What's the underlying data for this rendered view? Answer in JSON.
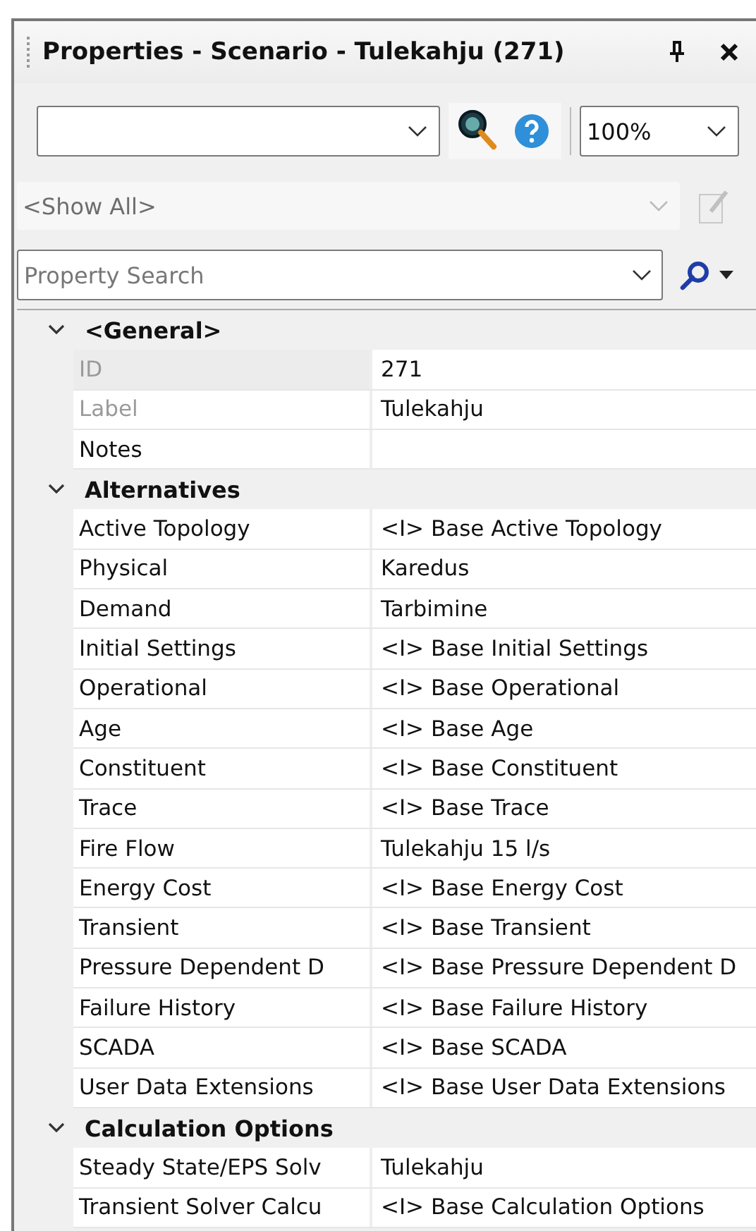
{
  "window": {
    "title": "Properties - Scenario - Tulekahju (271)"
  },
  "zoom": {
    "value": "100%"
  },
  "filter": {
    "value": "<Show All>",
    "disabled": true
  },
  "search": {
    "placeholder": "Property Search"
  },
  "categories": [
    {
      "label": "<General>",
      "expanded": true,
      "rows": [
        {
          "name": "ID",
          "value": "271",
          "disabled": true,
          "selected": true
        },
        {
          "name": "Label",
          "value": "Tulekahju",
          "disabled": true,
          "selected": false
        },
        {
          "name": "Notes",
          "disabled": false,
          "selected": false
        }
      ]
    },
    {
      "label": "Alternatives",
      "expanded": true,
      "rows": [
        {
          "name": "Active Topology",
          "value": "<I> Base Active Topology",
          "disabled": false,
          "selected": false
        },
        {
          "name": "Physical",
          "value": "Karedus",
          "disabled": false,
          "selected": false
        },
        {
          "name": "Demand",
          "value": "Tarbimine",
          "disabled": false,
          "selected": false
        },
        {
          "name": "Initial Settings",
          "value": "<I> Base Initial Settings",
          "disabled": false,
          "selected": false
        },
        {
          "name": "Operational",
          "value": "<I> Base Operational",
          "disabled": false,
          "selected": false
        },
        {
          "name": "Age",
          "value": "<I> Base Age",
          "disabled": false,
          "selected": false
        },
        {
          "name": "Constituent",
          "value": "<I> Base Constituent",
          "disabled": false,
          "selected": false
        },
        {
          "name": "Trace",
          "value": "<I> Base Trace",
          "disabled": false,
          "selected": false
        },
        {
          "name": "Fire Flow",
          "value": "Tulekahju 15 l/s",
          "disabled": false,
          "selected": false
        },
        {
          "name": "Energy Cost",
          "value": "<I> Base Energy Cost",
          "disabled": false,
          "selected": false
        },
        {
          "name": "Transient",
          "value": "<I> Base Transient",
          "disabled": false,
          "selected": false
        },
        {
          "name": "Pressure Dependent D",
          "value": "<I> Base Pressure Dependent D",
          "disabled": false,
          "selected": false
        },
        {
          "name": "Failure History",
          "value": "<I> Base Failure History",
          "disabled": false,
          "selected": false
        },
        {
          "name": "SCADA",
          "value": "<I> Base SCADA",
          "disabled": false,
          "selected": false
        },
        {
          "name": "User Data Extensions",
          "value": "<I> Base User Data Extensions",
          "disabled": false,
          "selected": false
        }
      ]
    },
    {
      "label": "Calculation Options",
      "expanded": true,
      "rows": [
        {
          "name": "Steady State/EPS Solv",
          "value": "Tulekahju",
          "disabled": false,
          "selected": false
        },
        {
          "name": "Transient Solver Calcu",
          "value": "<I> Base Calculation Options",
          "disabled": false,
          "selected": false
        }
      ]
    }
  ]
}
